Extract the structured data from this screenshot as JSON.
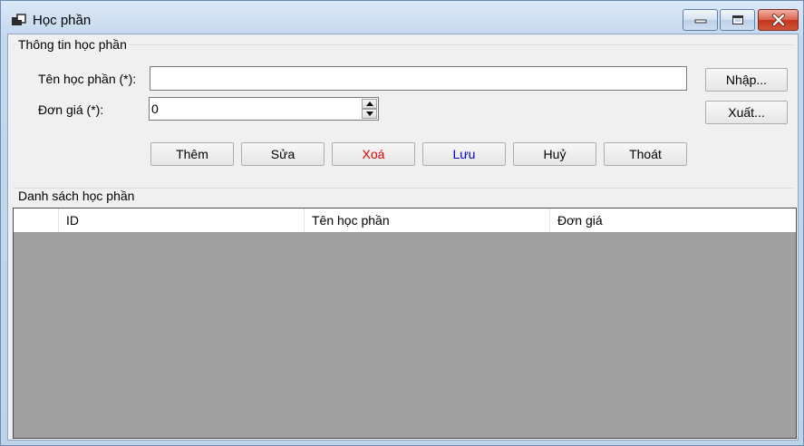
{
  "window": {
    "title": "Học phần",
    "icons": [
      "app-icon",
      "minimize-icon",
      "maximize-icon",
      "close-icon"
    ],
    "close_color": "#c6341d"
  },
  "info_group": {
    "legend": "Thông tin học phần",
    "name_label": "Tên học phần (*):",
    "name_value": "",
    "price_label": "Đơn giá (*):",
    "price_value": "0"
  },
  "side_buttons": {
    "import_label": "Nhập...",
    "export_label": "Xuất..."
  },
  "actions": {
    "add_label": "Thêm",
    "edit_label": "Sửa",
    "delete_label": "Xoá",
    "delete_color": "#e00000",
    "save_label": "Lưu",
    "save_color": "#0000cc",
    "cancel_label": "Huỷ",
    "exit_label": "Thoát"
  },
  "list_group": {
    "legend": "Danh sách học phần",
    "columns": [
      "ID",
      "Tên học phần",
      "Đơn giá"
    ],
    "rows": []
  }
}
